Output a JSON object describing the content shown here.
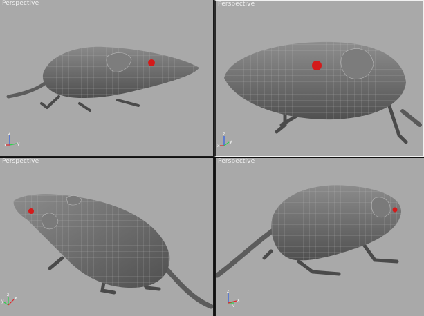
{
  "viewports": [
    {
      "id": "top-left",
      "label": "Perspective"
    },
    {
      "id": "top-right",
      "label": "Perspective"
    },
    {
      "id": "bottom-left",
      "label": "Perspective"
    },
    {
      "id": "bottom-right",
      "label": "Perspective"
    }
  ],
  "axis": {
    "x": "x",
    "y": "y",
    "z": "z"
  },
  "colors": {
    "viewport_bg": "#a9a9a9",
    "mesh_fill": "#6e6e6e",
    "mesh_wire": "#b8b8b8",
    "eye": "#d41a1a",
    "axis_x": "#e0262a",
    "axis_y": "#2bd24a",
    "axis_z": "#2b5de8"
  }
}
